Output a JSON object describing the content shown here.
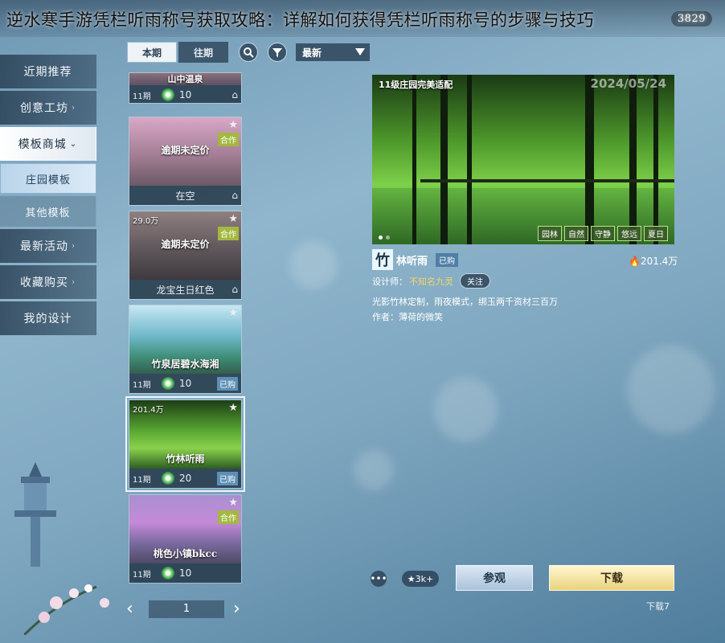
{
  "banner": {
    "title": "逆水寒手游凭栏听雨称号获取攻略：详解如何获得凭栏听雨称号的步骤与技巧",
    "currency": "3829"
  },
  "nav": {
    "items": [
      {
        "label": "近期推荐",
        "arrow": ""
      },
      {
        "label": "创意工坊",
        "arrow": "›"
      },
      {
        "label": "模板商城",
        "arrow": "⌄"
      },
      {
        "label": "庄园模板",
        "arrow": ""
      },
      {
        "label": "其他模板",
        "arrow": ""
      },
      {
        "label": "最新活动",
        "arrow": "›"
      },
      {
        "label": "收藏购买",
        "arrow": "›"
      },
      {
        "label": "我的设计",
        "arrow": ""
      }
    ]
  },
  "toolbar": {
    "tab_current": "本期",
    "tab_past": "往期",
    "sort": "最新"
  },
  "cards": [
    {
      "name": "山中温泉",
      "period": "11期",
      "price": "10",
      "heat": "",
      "badge": "",
      "owned": ""
    },
    {
      "name": "逾期未定价",
      "period": "",
      "price": "在空",
      "heat": "",
      "badge": "合作",
      "owned": ""
    },
    {
      "name": "逾期未定价",
      "period": "",
      "price": "龙宝生日红色",
      "heat": "29.0万",
      "badge": "合作",
      "owned": ""
    },
    {
      "name": "竹泉居碧水海湘",
      "period": "11期",
      "price": "10",
      "heat": "",
      "badge": "",
      "owned": "已购"
    },
    {
      "name": "竹林听雨",
      "period": "11期",
      "price": "20",
      "heat": "201.4万",
      "badge": "",
      "owned": "已购"
    },
    {
      "name": "桃色小镇bkcc",
      "period": "11期",
      "price": "10",
      "heat": "",
      "badge": "合作",
      "owned": ""
    }
  ],
  "pager": {
    "page": "1"
  },
  "preview": {
    "caption": "11级庄园完美适配",
    "date": "2024/05/24",
    "tags": [
      "园林",
      "自然",
      "守静",
      "悠远",
      "夏日"
    ]
  },
  "design": {
    "chip": "竹",
    "name": "林听雨",
    "owned": "已购",
    "heat": "201.4万",
    "designer_label": "设计师：",
    "designer": "不知名九灵",
    "follow": "关注",
    "desc1": "光影竹林定制，雨夜模式，绑玉两千资材三百万",
    "desc2": "作者：薄荷的微笑"
  },
  "actions": {
    "likes": "3k+",
    "view": "参观",
    "download": "下载",
    "download_count": "下载7"
  }
}
